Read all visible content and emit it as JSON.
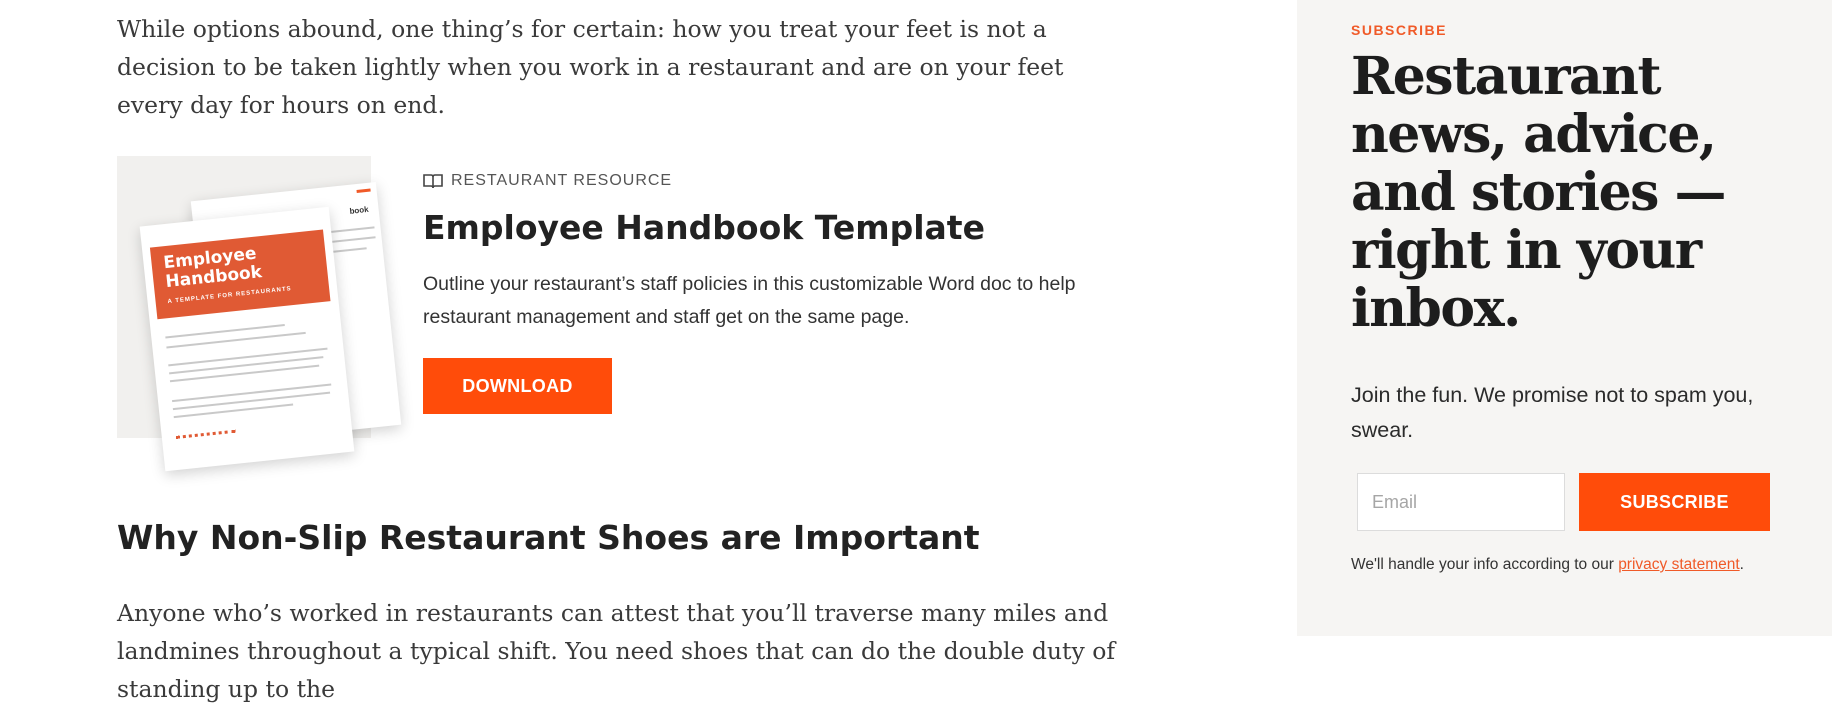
{
  "article": {
    "intro": "While options abound, one thing’s for certain: how you treat your feet is not a decision to be taken lightly when you work in a restaurant and are on your feet every day for hours on end.",
    "resource": {
      "label": "RESTAURANT RESOURCE",
      "icon": "book-icon",
      "title": "Employee Handbook Template",
      "description": "Outline your restaurant’s staff policies in this customizable Word doc to help restaurant management and staff get on the same page.",
      "button": "DOWNLOAD",
      "thumbnail": {
        "title": "Employee Handbook",
        "subtitle": "A TEMPLATE FOR RESTAURANTS",
        "back_heading": "book"
      }
    },
    "section_heading": "Why Non-Slip Restaurant Shoes are Important",
    "body": "Anyone who’s worked in restaurants can attest that you’ll traverse many miles and landmines throughout a typical shift. You need shoes that can do the double duty of standing up to the"
  },
  "sidebar": {
    "eyebrow": "SUBSCRIBE",
    "headline": "Restaurant news, advice, and stories — right in your inbox.",
    "tagline": "Join the fun. We promise not to spam you, swear.",
    "email_placeholder": "Email",
    "button": "SUBSCRIBE",
    "legal_prefix": "We'll handle your info according to our ",
    "legal_link": "privacy statement",
    "legal_suffix": "."
  },
  "colors": {
    "accent": "#ff4c0a",
    "sidebar_bg": "#f6f5f3",
    "handbook_cover": "#e05a34"
  }
}
